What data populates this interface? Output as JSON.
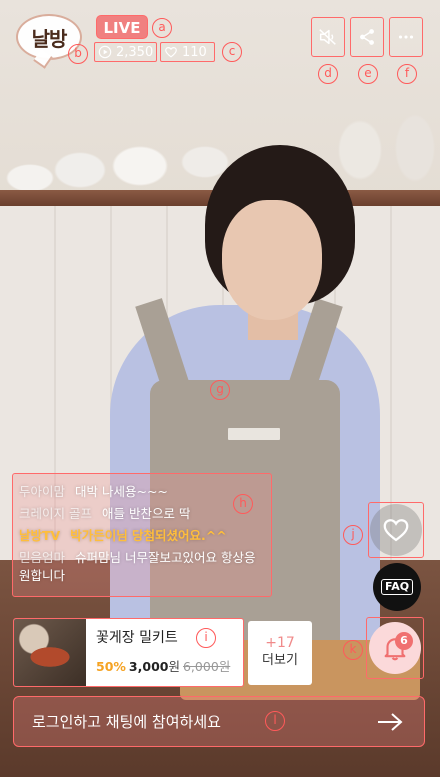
{
  "brand": {
    "logo_text": "날방"
  },
  "header": {
    "live_label": "LIVE",
    "view_count": "2,350",
    "like_count": "110",
    "buttons": [
      {
        "icon": "mute-icon"
      },
      {
        "icon": "share-icon"
      },
      {
        "icon": "more-icon"
      }
    ]
  },
  "markers": {
    "a": "a",
    "b": "b",
    "c": "c",
    "d": "d",
    "e": "e",
    "f": "f",
    "g": "g",
    "h": "h",
    "i": "i",
    "j": "j",
    "k": "k",
    "l": "l"
  },
  "chat": {
    "messages": [
      {
        "nick": "두아이맘",
        "text": "대박 나세용~~~",
        "highlight": false
      },
      {
        "nick": "크레이지 골프",
        "text": "애들 반찬으로 딱",
        "highlight": false
      },
      {
        "nick": "날방TV",
        "text": "박가든이님 당첨되셨어요.^^",
        "highlight": true
      },
      {
        "nick": "믿음엄마",
        "text": "슈퍼맘님 너무잘보고있어요 항상응원합니다",
        "highlight": false
      }
    ]
  },
  "side": {
    "faq_label": "FAQ",
    "coupon_count": "6"
  },
  "product": {
    "name": "꽃게장 밀키트",
    "discount_rate": "50%",
    "price": "3,000",
    "currency": "원",
    "original_price": "6,000원"
  },
  "more": {
    "count": "+17",
    "label": "더보기"
  },
  "input": {
    "placeholder": "로그인하고 채팅에 참여하세요"
  },
  "colors": {
    "highlight_border": "#ff6a6a",
    "live_badge": "#f08080",
    "accent_yellow": "#ffbe3b",
    "discount_orange": "#f5a323"
  }
}
